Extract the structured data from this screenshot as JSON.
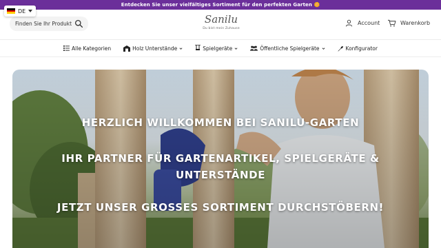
{
  "announcement": "Entdecken Sie unser vielfältiges Sortiment für den perfekten Garten 🌼",
  "language": {
    "code": "DE",
    "flag": [
      "#000000",
      "#dd0000",
      "#ffce00"
    ]
  },
  "search": {
    "placeholder": "Finden Sie Ihr Produkt",
    "icon": "search-icon"
  },
  "logo": {
    "brand": "Sanilu",
    "tagline": "Du bist mein Zuhause"
  },
  "header": {
    "account_label": "Account",
    "cart_label": "Warenkorb"
  },
  "nav": {
    "items": [
      {
        "label": "Alle Kategorien",
        "icon": "list-icon"
      },
      {
        "label": "Holz Unterstände",
        "icon": "shed-icon",
        "has_dropdown": true
      },
      {
        "label": "Spielgeräte",
        "icon": "swing-icon",
        "has_dropdown": true
      },
      {
        "label": "Öffentliche Spielgeräte",
        "icon": "people-icon",
        "has_dropdown": true
      },
      {
        "label": "Konfigurator",
        "icon": "wrench-icon"
      }
    ]
  },
  "hero": {
    "line1": "HERZLICH WILLKOMMEN BEI SANILU-GARTEN",
    "line2": "IHR PARTNER FÜR GARTENARTIKEL, SPIELGERÄTE & UNTERSTÄNDE",
    "line3": "JETZT UNSER GROSSES SORTIMENT DURCHSTÖBERN!"
  },
  "colors": {
    "announcement_bg": "#6b2f9a",
    "text": "#222222",
    "hero_text": "#ffffff"
  }
}
